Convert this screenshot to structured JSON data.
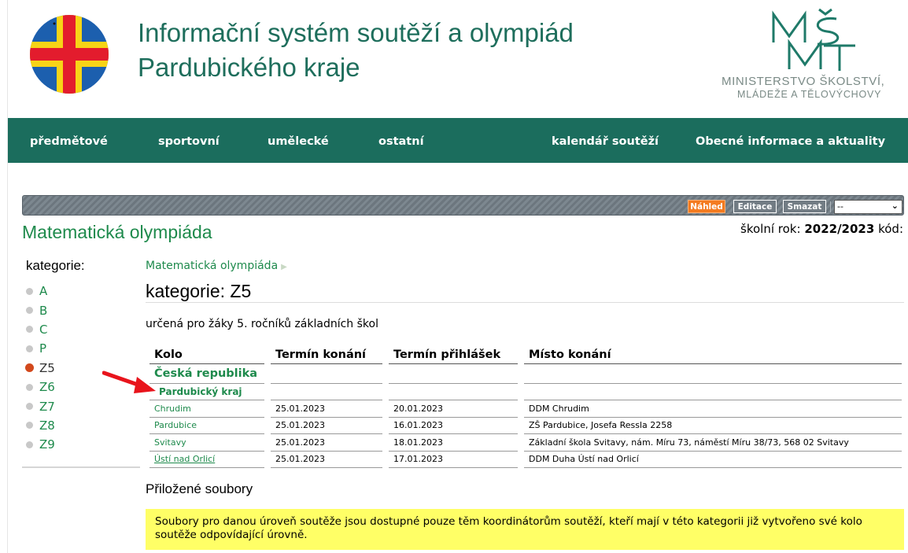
{
  "header": {
    "title_line1": "Informační systém soutěží a olympiád",
    "title_line2": "Pardubického kraje",
    "ministry_logo_text": "MŠMT",
    "ministry_line1": "MINISTERSTVO ŠKOLSTVÍ,",
    "ministry_line2": "MLÁDEŽE A TĚLOVÝCHOVY",
    "logo_colors": {
      "blue": "#1c5fae",
      "yellow": "#f7d417",
      "red": "#e31c2d"
    }
  },
  "nav": {
    "items": [
      "předmětové",
      "sportovní",
      "umělecké",
      "ostatní",
      "kalendář soutěží",
      "Obecné informace a aktuality"
    ],
    "background": "#1b6d5d"
  },
  "admin": {
    "preview": "Náhled",
    "edit": "Editace",
    "delete": "Smazat",
    "select_value": "--"
  },
  "competition": {
    "title": "Matematická olympiáda",
    "school_year_label": "školní rok:",
    "school_year_value": "2022/2023",
    "code_label": "kód:"
  },
  "sidebar": {
    "heading": "kategorie:",
    "categories": [
      "A",
      "B",
      "C",
      "P",
      "Z5",
      "Z6",
      "Z7",
      "Z8",
      "Z9"
    ],
    "active": "Z5"
  },
  "main": {
    "breadcrumb": "Matematická olympiáda",
    "category_title": "kategorie: Z5",
    "description": "určená pro žáky 5. ročníků základních škol",
    "table": {
      "headers": [
        "Kolo",
        "Termín konání",
        "Termín přihlášek",
        "Místo konání"
      ],
      "level1": "Česká republika",
      "level2": "Pardubický kraj",
      "rows": [
        {
          "kolo": "Chrudim",
          "termin": "25.01.2023",
          "prihlasky": "20.01.2023",
          "misto": "DDM Chrudim"
        },
        {
          "kolo": "Pardubice",
          "termin": "25.01.2023",
          "prihlasky": "16.01.2023",
          "misto": "ZŠ Pardubice, Josefa Ressla 2258"
        },
        {
          "kolo": "Svitavy",
          "termin": "25.01.2023",
          "prihlasky": "18.01.2023",
          "misto": "Základní škola Svitavy, nám. Míru 73, náměstí Míru 38/73, 568 02 Svitavy"
        },
        {
          "kolo": "Ústí nad Orlicí",
          "termin": "25.01.2023",
          "prihlasky": "17.01.2023",
          "misto": "DDM Duha Ústí nad Orlicí"
        }
      ]
    },
    "attachments_title": "Přiložené soubory",
    "notice": "Soubory pro danou úroveň soutěže jsou dostupné pouze těm koordinátorům soutěží, kteří mají v této kategorii již vytvořeno své kolo soutěže odpovídající úrovně."
  }
}
